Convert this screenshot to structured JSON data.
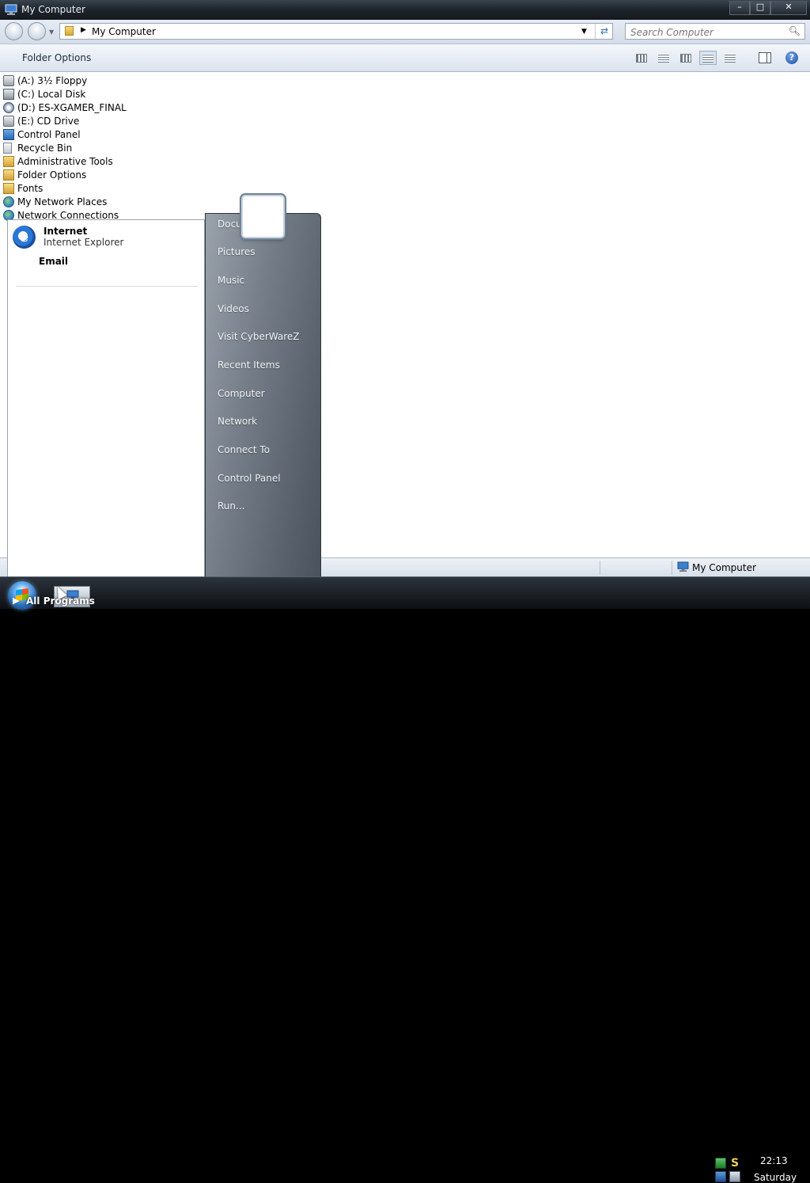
{
  "window": {
    "title": "My Computer",
    "min_glyph": "–",
    "max_glyph": "□",
    "close_glyph": "✕"
  },
  "address": {
    "breadcrumb_sep": "▶",
    "path": "My Computer",
    "dropdown_glyph": "▼",
    "refresh_glyph": "⇄"
  },
  "search": {
    "placeholder": "Search Computer"
  },
  "command_bar": {
    "folder_options": "Folder Options",
    "help_glyph": "?"
  },
  "items": [
    {
      "label": "(A:) 3½ Floppy",
      "icon": "floppy-drive-icon"
    },
    {
      "label": "(C:) Local Disk",
      "icon": "hard-disk-icon"
    },
    {
      "label": "(D:) ES-XGAMER_FINAL",
      "icon": "cd-disc-icon"
    },
    {
      "label": "(E:) CD Drive",
      "icon": "cd-drive-icon"
    },
    {
      "label": "Control Panel",
      "icon": "control-panel-icon"
    },
    {
      "label": "Recycle Bin",
      "icon": "recycle-bin-icon"
    },
    {
      "label": "Administrative Tools",
      "icon": "folder-icon"
    },
    {
      "label": "Folder Options",
      "icon": "folder-options-icon"
    },
    {
      "label": "Fonts",
      "icon": "fonts-folder-icon"
    },
    {
      "label": "My Network Places",
      "icon": "network-globe-icon"
    },
    {
      "label": "Network Connections",
      "icon": "network-globe-icon"
    }
  ],
  "status_bar": {
    "location": "My Computer"
  },
  "start_menu": {
    "pinned": {
      "internet_title": "Internet",
      "internet_sub": "Internet Explorer",
      "ie_glyph": "e",
      "email": "Email"
    },
    "right_items": [
      "Documents",
      "Pictures",
      "Music",
      "Videos",
      "Visit CyberWareZ",
      "Recent Items",
      "Computer",
      "Network",
      "Connect To",
      "Control Panel",
      "Run..."
    ],
    "all_programs": "All Programs",
    "all_programs_arrow": "▶"
  },
  "taskbar": {
    "time": "22:13",
    "day": "Saturday",
    "tray_s_glyph": "S"
  },
  "colors": {
    "titlebar": "#1f252c",
    "start_menu_right": "#747d88",
    "taskbar": "#0d1014"
  }
}
